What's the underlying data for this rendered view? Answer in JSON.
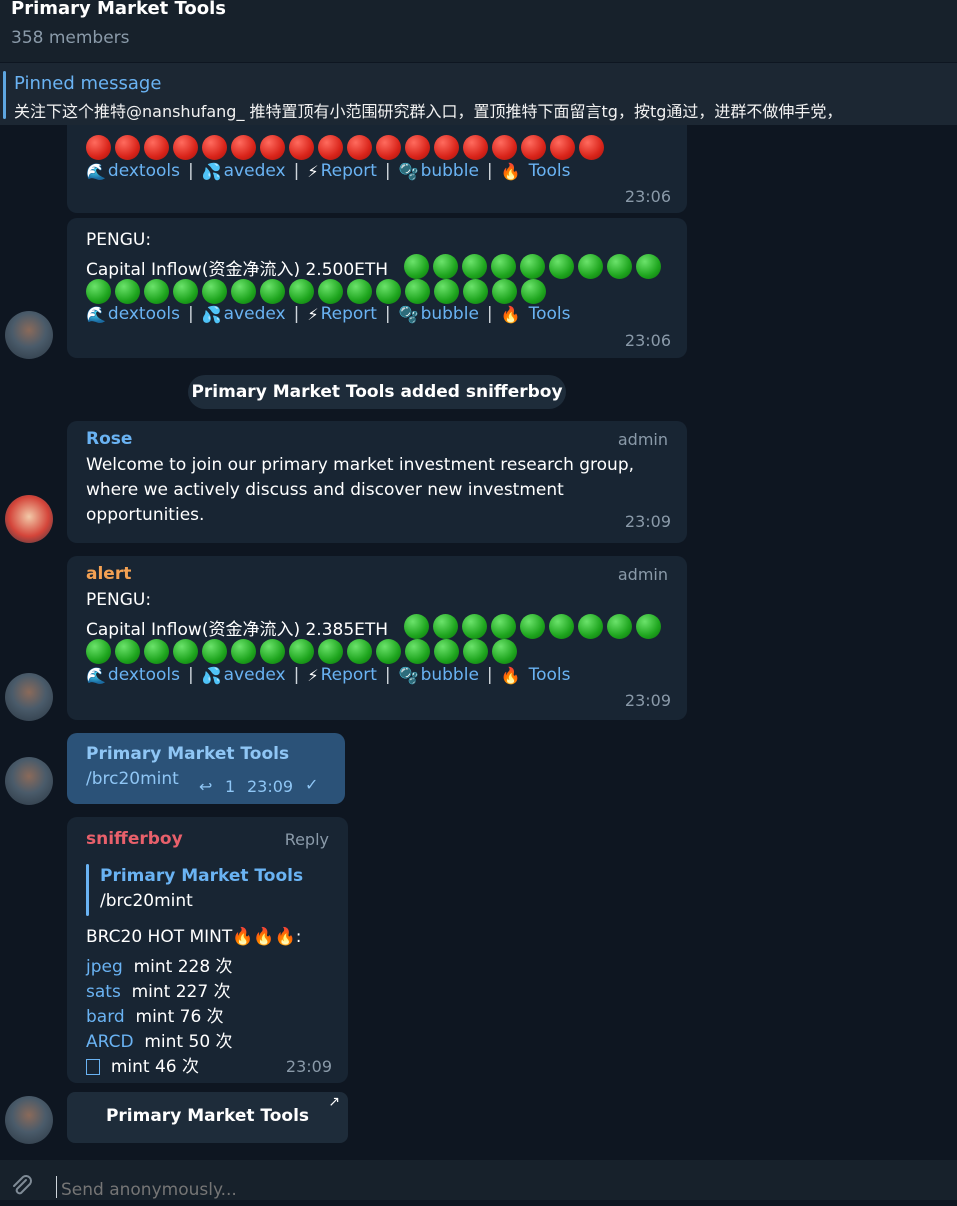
{
  "header": {
    "title": "Primary Market Tools",
    "members": "358 members"
  },
  "pinned": {
    "title": "Pinned message",
    "text": "关注下这个推特@nanshufang_ 推特置顶有小范围研究群入口，置顶推特下面留言tg，按tg通过，进群不做伸手党，"
  },
  "tools": {
    "dextools": "dextools",
    "avedex": "avedex",
    "report": "Report",
    "bubble": "bubble",
    "tools": "Tools",
    "sep": "|"
  },
  "messages": {
    "m1": {
      "time": "23:06"
    },
    "m2": {
      "line1": "PENGU:",
      "line2": "Capital Inflow(资金净流入) 2.500ETH",
      "time": "23:06"
    },
    "service": "Primary Market Tools added snifferboy",
    "m3": {
      "name": "Rose",
      "role": "admin",
      "l1": "Welcome to join our primary market investment research group,",
      "l2": "where we actively discuss and discover new investment",
      "l3": "opportunities.",
      "time": "23:09"
    },
    "m4": {
      "name": "alert",
      "role": "admin",
      "line1": "PENGU:",
      "line2": "Capital Inflow(资金净流入) 2.385ETH",
      "time": "23:09"
    },
    "m5": {
      "name": "Primary Market Tools",
      "text": "/brc20mint",
      "replies": "1",
      "time": "23:09"
    },
    "m6": {
      "name": "snifferboy",
      "reply": "Reply",
      "quote_name": "Primary Market Tools",
      "quote_text": "/brc20mint",
      "heading": "BRC20 HOT MINT🔥🔥🔥:",
      "rows": [
        {
          "token": "jpeg",
          "count": "mint 228 次"
        },
        {
          "token": "sats",
          "count": "mint 227 次"
        },
        {
          "token": "bard",
          "count": "mint 76 次"
        },
        {
          "token": "ARCD",
          "count": "mint 50 次"
        },
        {
          "token": "",
          "count": "mint 46 次"
        }
      ],
      "time": "23:09"
    }
  },
  "inline_button": {
    "label": "Primary Market Tools",
    "arrow": "↗"
  },
  "composer": {
    "placeholder": "Send anonymously..."
  },
  "icons": {
    "dextools": "wave-icon",
    "avedex": "droplets-icon",
    "report": "lightning-icon",
    "bubble": "bubbles-icon",
    "tools": "fire-icon",
    "attach": "paperclip-icon",
    "reply": "reply-arrow-icon",
    "check": "checkmark-icon"
  },
  "colors": {
    "background": "#0e1621",
    "bubble_in": "#182533",
    "bubble_out": "#2b5278",
    "link": "#6ab3f3",
    "alert_name": "#f3a153",
    "snifferboy_name": "#e8606b"
  },
  "chart_data": null
}
